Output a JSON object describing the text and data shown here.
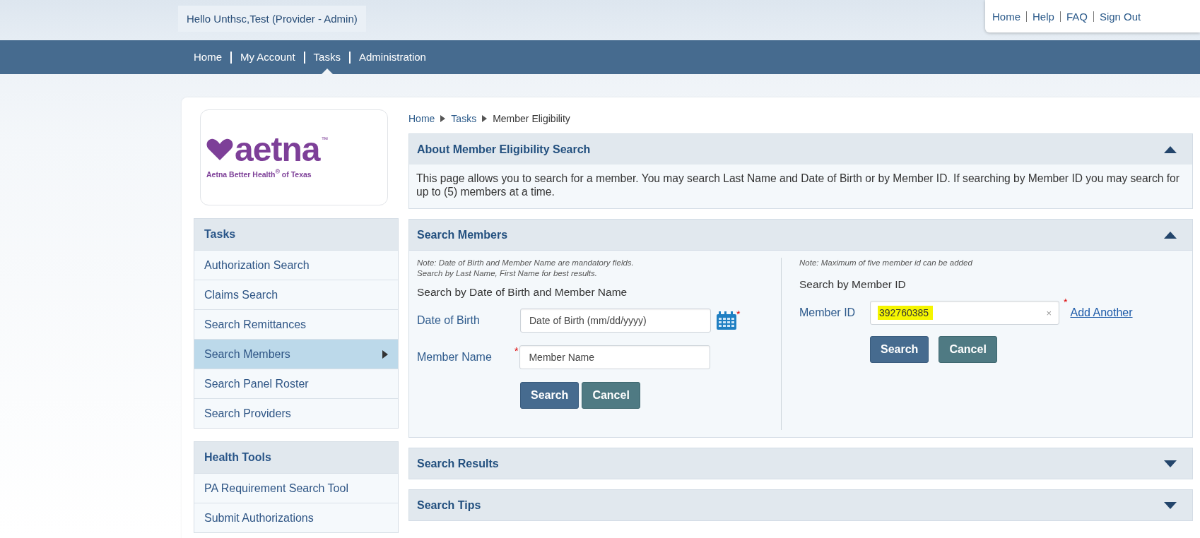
{
  "header": {
    "greeting": "Hello Unthsc,Test (Provider - Admin)",
    "links": [
      "Home",
      "Help",
      "FAQ",
      "Sign Out"
    ]
  },
  "nav": {
    "items": [
      {
        "label": "Home",
        "selected": false
      },
      {
        "label": "My Account",
        "selected": false
      },
      {
        "label": "Tasks",
        "selected": true
      },
      {
        "label": "Administration",
        "selected": false
      }
    ]
  },
  "logo": {
    "wordmark": "aetna",
    "trademark": "™",
    "tagline": "Aetna Better Health$^{®}$ of Texas"
  },
  "sidebar": {
    "sections": [
      {
        "title": "Tasks",
        "items": [
          {
            "label": "Authorization Search",
            "selected": false
          },
          {
            "label": "Claims Search",
            "selected": false
          },
          {
            "label": "Search Remittances",
            "selected": false
          },
          {
            "label": "Search Members",
            "selected": true
          },
          {
            "label": "Search Panel Roster",
            "selected": false
          },
          {
            "label": "Search Providers",
            "selected": false
          }
        ]
      },
      {
        "title": "Health Tools",
        "items": [
          {
            "label": "PA Requirement Search Tool",
            "selected": false
          },
          {
            "label": "Submit Authorizations",
            "selected": false
          }
        ]
      }
    ]
  },
  "breadcrumb": [
    "Home",
    "Tasks",
    "Member Eligibility"
  ],
  "panels": [
    {
      "kind": "text",
      "title": "About Member Eligibility Search",
      "expanded": true,
      "text": "This page allows you to search for a member. You may search Last Name and Date of Birth or by Member ID. If searching by Member ID you may search for up to (5) members at a time."
    },
    {
      "kind": "search",
      "title": "Search Members",
      "expanded": true,
      "left": {
        "note": "Note: Date of Birth and Member Name are mandatory fields.\nSearch by Last Name, First Name for best results.",
        "heading": "Search by Date of Birth and Member Name",
        "fields": [
          {
            "kind": "date",
            "label": "Date of Birth",
            "placeholder": "Date of Birth (mm/dd/yyyy)",
            "required_mark": "*"
          },
          {
            "kind": "text",
            "label": "Member Name",
            "placeholder": "Member Name",
            "required_mark": "*"
          }
        ],
        "buttons": [
          {
            "kind": "primary",
            "label": "Search"
          },
          {
            "kind": "secondary",
            "label": "Cancel"
          }
        ]
      },
      "right": {
        "note": "Note: Maximum of five member id can be added",
        "heading": "Search by Member ID",
        "field": {
          "label": "Member ID",
          "value": "392760385",
          "highlighted": true,
          "clear": "×",
          "required_mark": "*"
        },
        "link": "Add Another",
        "buttons": [
          {
            "kind": "primary",
            "label": "Search"
          },
          {
            "kind": "secondary",
            "label": "Cancel"
          }
        ]
      }
    },
    {
      "title": "Search Results",
      "expanded": false
    },
    {
      "title": "Search Tips",
      "expanded": false
    }
  ]
}
